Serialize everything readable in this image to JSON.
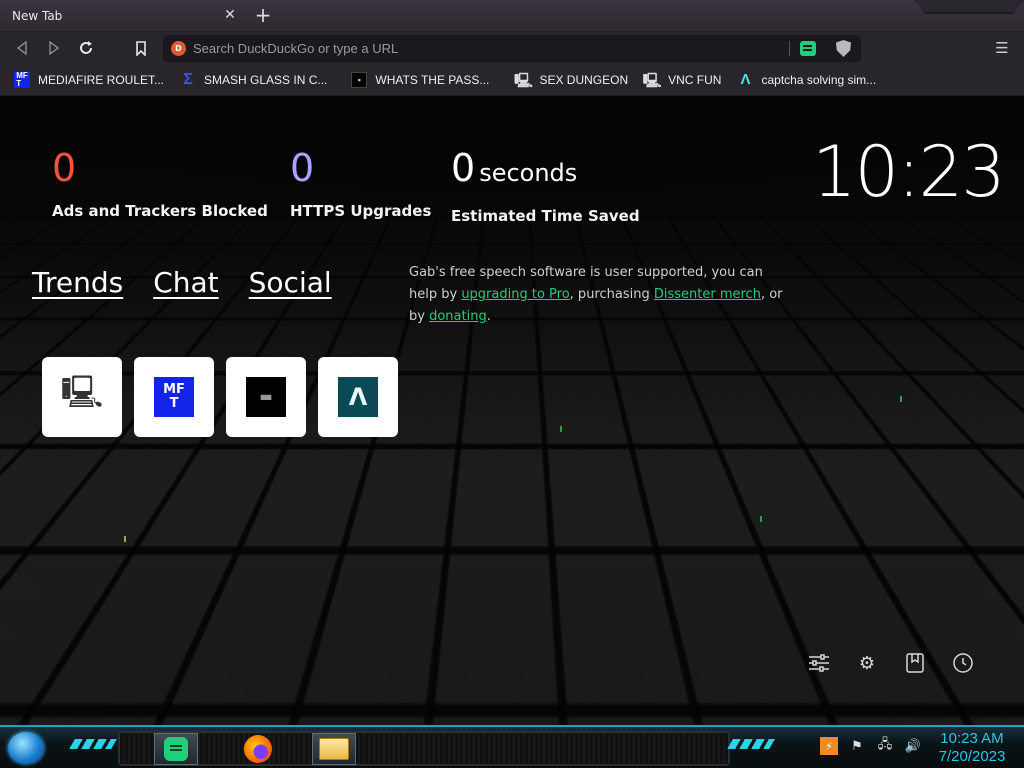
{
  "browser": {
    "tab_title": "New Tab",
    "tab_close_glyph": "✕",
    "new_tab_glyph": "+",
    "url_placeholder": "Search DuckDuckGo or type a URL",
    "url_value": ""
  },
  "bookmarks": [
    {
      "label": "MEDIAFIRE ROULET...",
      "icon": "mediafire-icon"
    },
    {
      "label": "SMASH GLASS IN C...",
      "icon": "smash-glass-icon"
    },
    {
      "label": "WHATS THE PASS...",
      "icon": "whats-the-pass-icon"
    },
    {
      "label": "SEX DUNGEON",
      "icon": "pc-icon"
    },
    {
      "label": "VNC FUN",
      "icon": "pc-icon"
    },
    {
      "label": "captcha solving sim...",
      "icon": "captcha-icon"
    }
  ],
  "stats": {
    "ads_blocked": {
      "value": "0",
      "label": "Ads and Trackers Blocked",
      "color": "#f9523b"
    },
    "https_upgrades": {
      "value": "0",
      "label": "HTTPS Upgrades",
      "color": "#a8a3ff"
    },
    "time_saved": {
      "value": "0",
      "unit": "seconds",
      "label": "Estimated Time Saved",
      "color": "#ffffff"
    }
  },
  "clock": "10:23",
  "gab": {
    "links": [
      "Trends",
      "Chat",
      "Social"
    ],
    "promo_part1": "Gab's free speech software is user supported, you can help by ",
    "promo_link1": "upgrading to Pro",
    "promo_part2": ", purchasing ",
    "promo_link2": "Dissenter merch",
    "promo_part3": ", or by ",
    "promo_link3": "donating",
    "promo_part4": ".",
    "accent": "#21cf7a"
  },
  "tiles": [
    {
      "name": "vnc-tile",
      "icon": "pc-icon"
    },
    {
      "name": "mediafire-tile",
      "icon": "mediafire-icon"
    },
    {
      "name": "whats-the-pass-tile",
      "icon": "whats-the-pass-icon"
    },
    {
      "name": "captcha-tile",
      "icon": "captcha-icon"
    }
  ],
  "ntp_actions": [
    "customize-icon",
    "settings-icon",
    "bookmarks-icon",
    "history-icon"
  ],
  "taskbar": {
    "time": "10:23 AM",
    "date": "7/20/2023",
    "accent": "#25c9e0"
  }
}
